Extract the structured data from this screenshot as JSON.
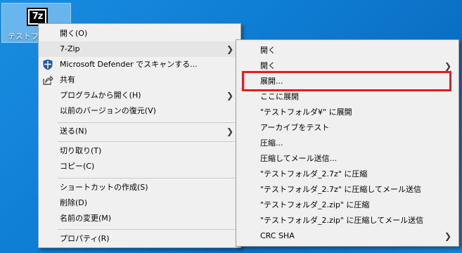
{
  "desktop": {
    "icon_label": "テストフォ",
    "logo_text": "7z"
  },
  "context_menu": {
    "items": [
      {
        "label": "開く(O)"
      },
      {
        "label": "7-Zip"
      },
      {
        "label": "Microsoft Defender でスキャンする..."
      },
      {
        "label": "共有"
      },
      {
        "label": "プログラムから開く(H)"
      },
      {
        "label": "以前のバージョンの復元(V)"
      },
      {
        "label": "送る(N)"
      },
      {
        "label": "切り取り(T)"
      },
      {
        "label": "コピー(C)"
      },
      {
        "label": "ショートカットの作成(S)"
      },
      {
        "label": "削除(D)"
      },
      {
        "label": "名前の変更(M)"
      },
      {
        "label": "プロパティ(R)"
      }
    ]
  },
  "submenu_7zip": {
    "items": [
      {
        "label": "開く"
      },
      {
        "label": "開く"
      },
      {
        "label": "展開..."
      },
      {
        "label": "ここに展開"
      },
      {
        "label": "\"テストフォルダ¥\" に展開"
      },
      {
        "label": "アーカイブをテスト"
      },
      {
        "label": "圧縮..."
      },
      {
        "label": "圧縮してメール送信..."
      },
      {
        "label": "\"テストフォルダ_2.7z\" に圧縮"
      },
      {
        "label": "\"テストフォルダ_2.7z\" に圧縮してメール送信"
      },
      {
        "label": "\"テストフォルダ_2.zip\" に圧縮"
      },
      {
        "label": "\"テストフォルダ_2.zip\" に圧縮してメール送信"
      },
      {
        "label": "CRC SHA"
      }
    ]
  },
  "colors": {
    "highlight": "#e02020",
    "desktop": "#0f7fd6",
    "menu_bg": "#f0f0f0"
  }
}
